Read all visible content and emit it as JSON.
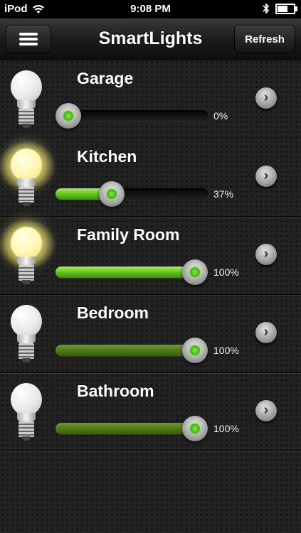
{
  "status_bar": {
    "carrier": "iPod",
    "time": "9:08 PM",
    "wifi_icon": "wifi-icon",
    "bluetooth_icon": "bluetooth-icon",
    "battery_icon": "battery-icon"
  },
  "nav": {
    "title": "SmartLights",
    "menu_icon": "menu-icon",
    "refresh_label": "Refresh"
  },
  "colors": {
    "accent_green": "#7cf03a",
    "background": "#222222"
  },
  "lights": [
    {
      "name": "Garage",
      "level": 0,
      "percent_label": "0%",
      "bulb_on": false
    },
    {
      "name": "Kitchen",
      "level": 37,
      "percent_label": "37%",
      "bulb_on": true
    },
    {
      "name": "Family Room",
      "level": 100,
      "percent_label": "100%",
      "bulb_on": true
    },
    {
      "name": "Bedroom",
      "level": 100,
      "percent_label": "100%",
      "bulb_on": false
    },
    {
      "name": "Bathroom",
      "level": 100,
      "percent_label": "100%",
      "bulb_on": false
    }
  ],
  "row_action_icon": "chevron-right-icon"
}
